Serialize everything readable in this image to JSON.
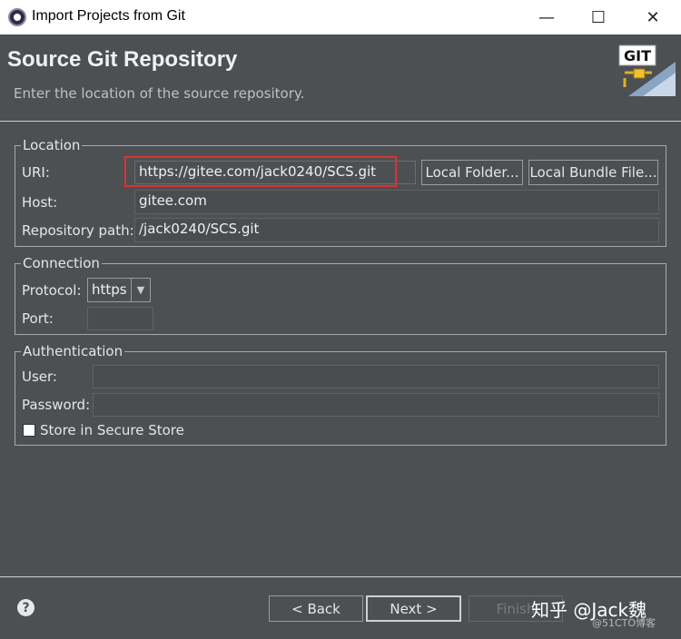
{
  "window": {
    "title": "Import Projects from Git",
    "minimize": "—",
    "maximize": "☐",
    "close": "✕"
  },
  "header": {
    "title": "Source Git Repository",
    "description": "Enter the location of the source repository.",
    "logo_text": "GIT"
  },
  "location": {
    "legend": "Location",
    "uri_label": "URI:",
    "uri_value": "https://gitee.com/jack0240/SCS.git",
    "host_label": "Host:",
    "host_value": "gitee.com",
    "repo_label": "Repository path:",
    "repo_value": "/jack0240/SCS.git",
    "local_folder_button": "Local Folder...",
    "local_bundle_button": "Local Bundle File..."
  },
  "connection": {
    "legend": "Connection",
    "protocol_label": "Protocol:",
    "protocol_value": "https",
    "port_label": "Port:",
    "port_value": ""
  },
  "authentication": {
    "legend": "Authentication",
    "user_label": "User:",
    "user_value": "",
    "password_label": "Password:",
    "password_value": "",
    "store_label": "Store in Secure Store",
    "store_checked": false
  },
  "footer": {
    "help": "?",
    "back_button": "< Back",
    "next_button": "Next >",
    "finish_button": "Finish"
  },
  "watermark": {
    "main": "知乎 @Jack魏",
    "sub": "@51CTO博客"
  },
  "colors": {
    "background": "#4d5052",
    "highlight": "#e03030",
    "titlebar": "#ffffff"
  }
}
